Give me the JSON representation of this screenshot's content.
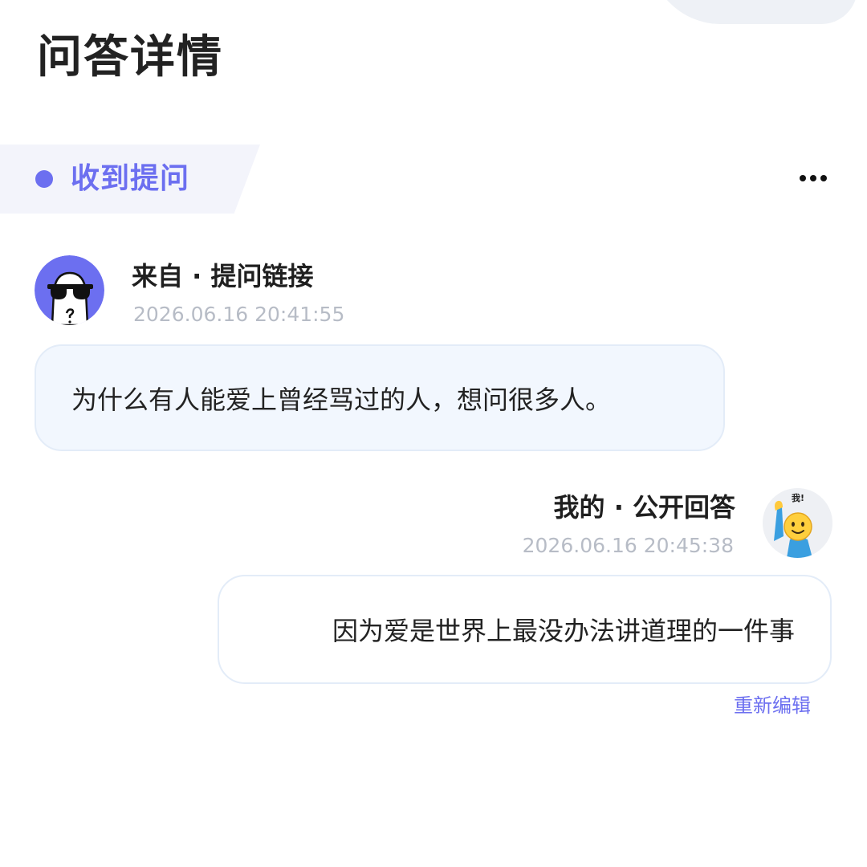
{
  "header": {
    "title": "问答详情"
  },
  "status": {
    "label": "收到提问",
    "accent_color": "#6c6ff0",
    "more_icon": "more-horizontal-icon"
  },
  "question": {
    "source": "来自 · 提问链接",
    "timestamp": "2026.06.16 20:41:55",
    "text": "为什么有人能爱上曾经骂过的人，想问很多人。",
    "avatar_icon": "sunglasses-ghost-avatar"
  },
  "answer": {
    "source": "我的 · 公开回答",
    "timestamp": "2026.06.16 20:45:38",
    "text": "因为爱是世界上最没办法讲道理的一件事",
    "avatar_icon": "raised-hand-emoji-avatar",
    "avatar_badge": "我!",
    "edit_label": "重新编辑"
  }
}
